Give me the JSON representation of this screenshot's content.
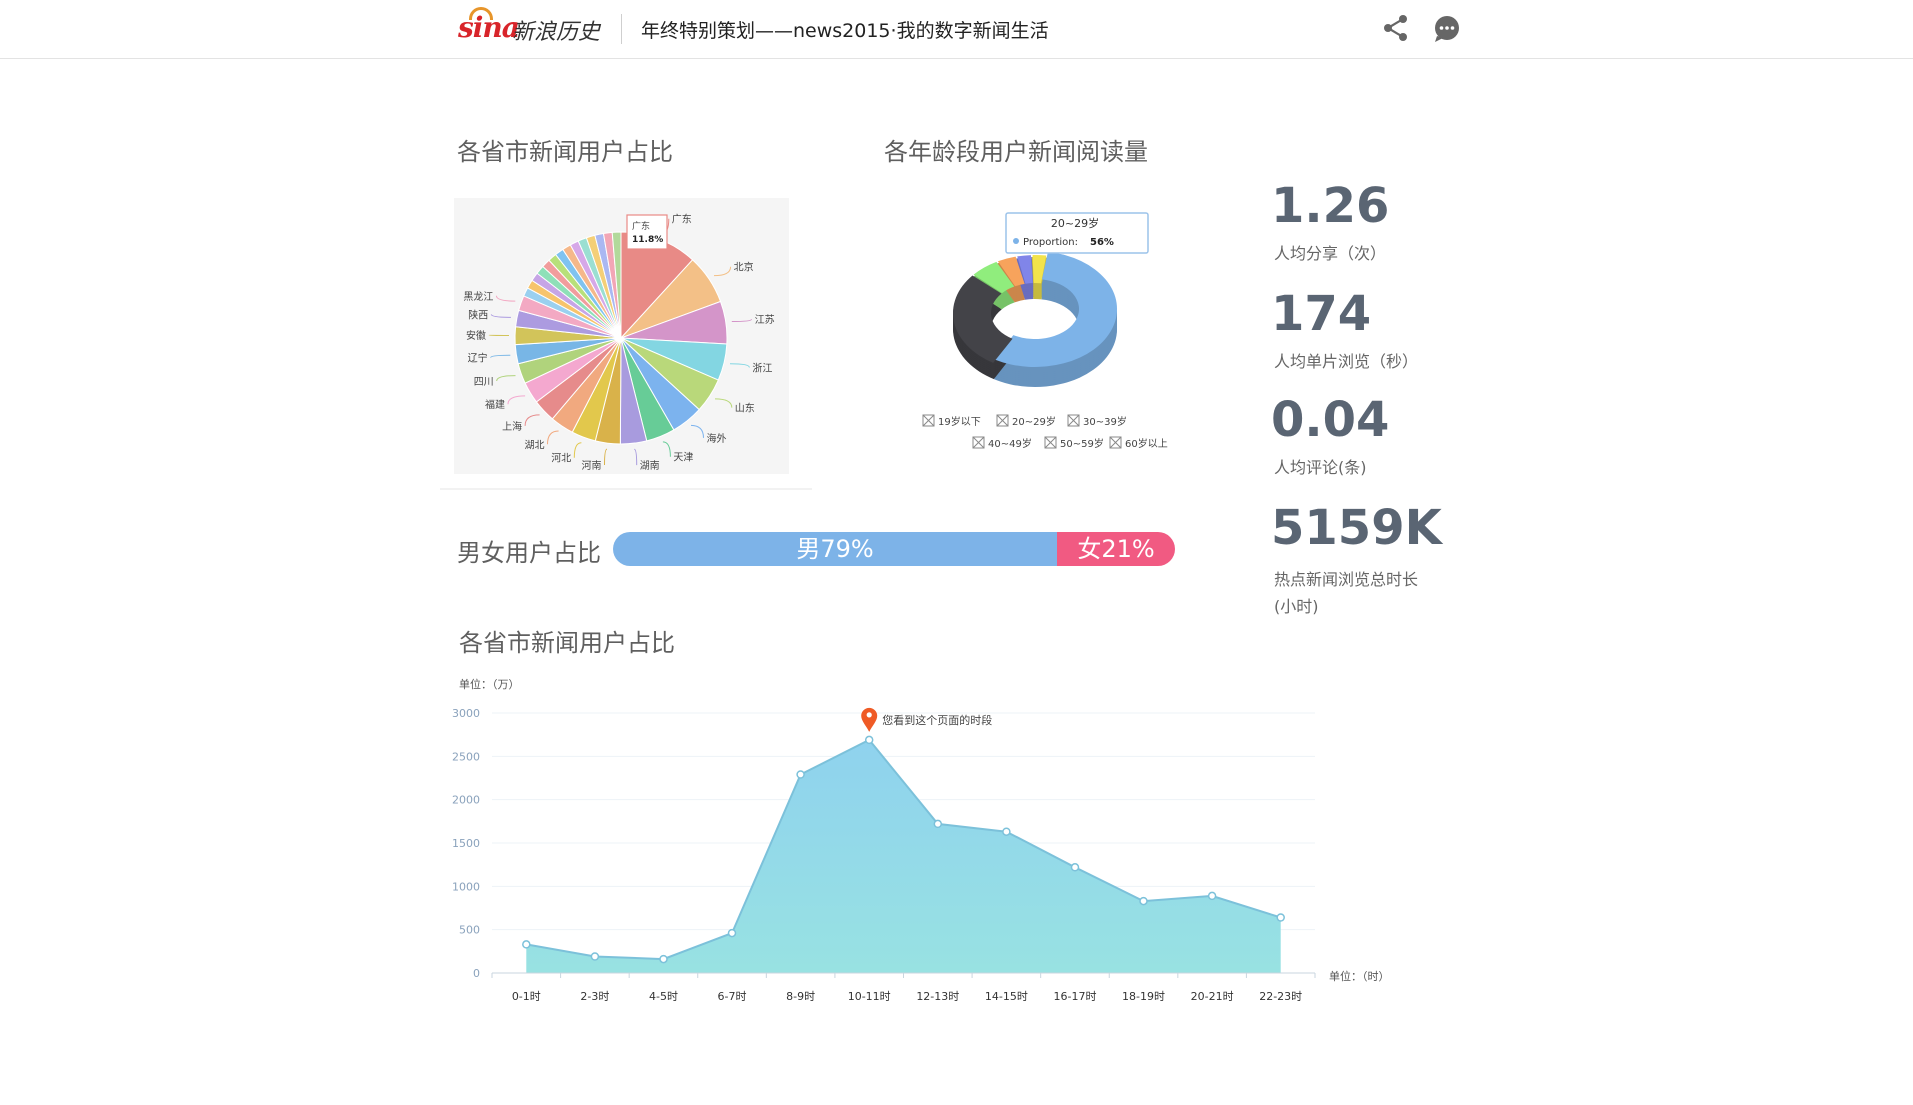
{
  "header": {
    "logo_mark": "sina",
    "logo_text": "新浪历史",
    "title": "年终特别策划——news2015·我的数字新闻生活",
    "icons": {
      "share": "share-icon",
      "comment": "comment-icon"
    }
  },
  "sections": {
    "province_pie_title": "各省市新闻用户占比",
    "age_donut_title": "各年龄段用户新闻阅读量",
    "gender_title": "男女用户占比",
    "hourly_title": "各省市新闻用户占比"
  },
  "stats": [
    {
      "value": "1.26",
      "label": "人均分享（次）"
    },
    {
      "value": "174",
      "label": "人均单片浏览（秒）"
    },
    {
      "value": "0.04",
      "label": "人均评论(条)"
    },
    {
      "value": "5159K",
      "label": "热点新闻浏览总时长",
      "label2": "(小时)"
    }
  ],
  "gender": {
    "male_label": "男79%",
    "female_label": "女21%",
    "male_fraction": 0.79,
    "male_color": "#7db3e8",
    "female_color": "#f15a82"
  },
  "chart_data": [
    {
      "type": "pie",
      "title": "各省市新闻用户占比",
      "tooltip": {
        "name": "广东",
        "value": "11.8%"
      },
      "categories": [
        "广东",
        "北京",
        "江苏",
        "浙江",
        "山东",
        "海外",
        "天津",
        "湖南",
        "河南",
        "河北",
        "湖北",
        "上海",
        "福建",
        "四川",
        "辽宁",
        "安徽",
        "陕西",
        "黑龙江"
      ],
      "values": [
        11.8,
        7.6,
        6.5,
        5.6,
        5.3,
        4.9,
        4.4,
        4.0,
        3.8,
        3.7,
        3.6,
        3.5,
        3.3,
        3.1,
        2.9,
        2.7,
        2.5,
        2.3
      ],
      "other_count": 14,
      "colors": [
        "#e88a86",
        "#f3c087",
        "#d495c9",
        "#83d6e2",
        "#b9d87a",
        "#7cb3ee",
        "#67cc97",
        "#a89bde",
        "#d9b24a",
        "#e2c84c",
        "#f1a97f",
        "#e68b8b",
        "#f4a8cf",
        "#b0d37c",
        "#78b6e6",
        "#d2c45a",
        "#ac9be0",
        "#f3a9c3"
      ]
    },
    {
      "type": "pie",
      "title": "各年龄段用户新闻阅读量",
      "donut": true,
      "tooltip": {
        "name": "20~29岁",
        "series": "Proportion",
        "value": "56%"
      },
      "categories": [
        "19岁以下",
        "20~29岁",
        "30~39岁",
        "40~49岁",
        "50~59岁",
        "60岁以上"
      ],
      "values": [
        3,
        56,
        28,
        6,
        4,
        3
      ],
      "colors": [
        "#f2e34c",
        "#7db3e8",
        "#434348",
        "#90ed7d",
        "#f7a35c",
        "#8085e9"
      ]
    },
    {
      "type": "area",
      "title": "各省市新闻用户占比",
      "ylabel": "单位：（万）",
      "xlabel": "单位：（时）",
      "categories": [
        "0-1时",
        "2-3时",
        "4-5时",
        "6-7时",
        "8-9时",
        "10-11时",
        "12-13时",
        "14-15时",
        "16-17时",
        "18-19时",
        "20-21时",
        "22-23时"
      ],
      "values": [
        330,
        190,
        160,
        460,
        2290,
        2690,
        1720,
        1630,
        1220,
        830,
        890,
        640
      ],
      "ylim": [
        0,
        3000
      ],
      "yticks": [
        "0",
        "500",
        "1000",
        "1500",
        "2000",
        "2500",
        "3000"
      ],
      "marker": {
        "index": 5,
        "label": "您看到这个页面的时段"
      },
      "grid": true
    }
  ]
}
